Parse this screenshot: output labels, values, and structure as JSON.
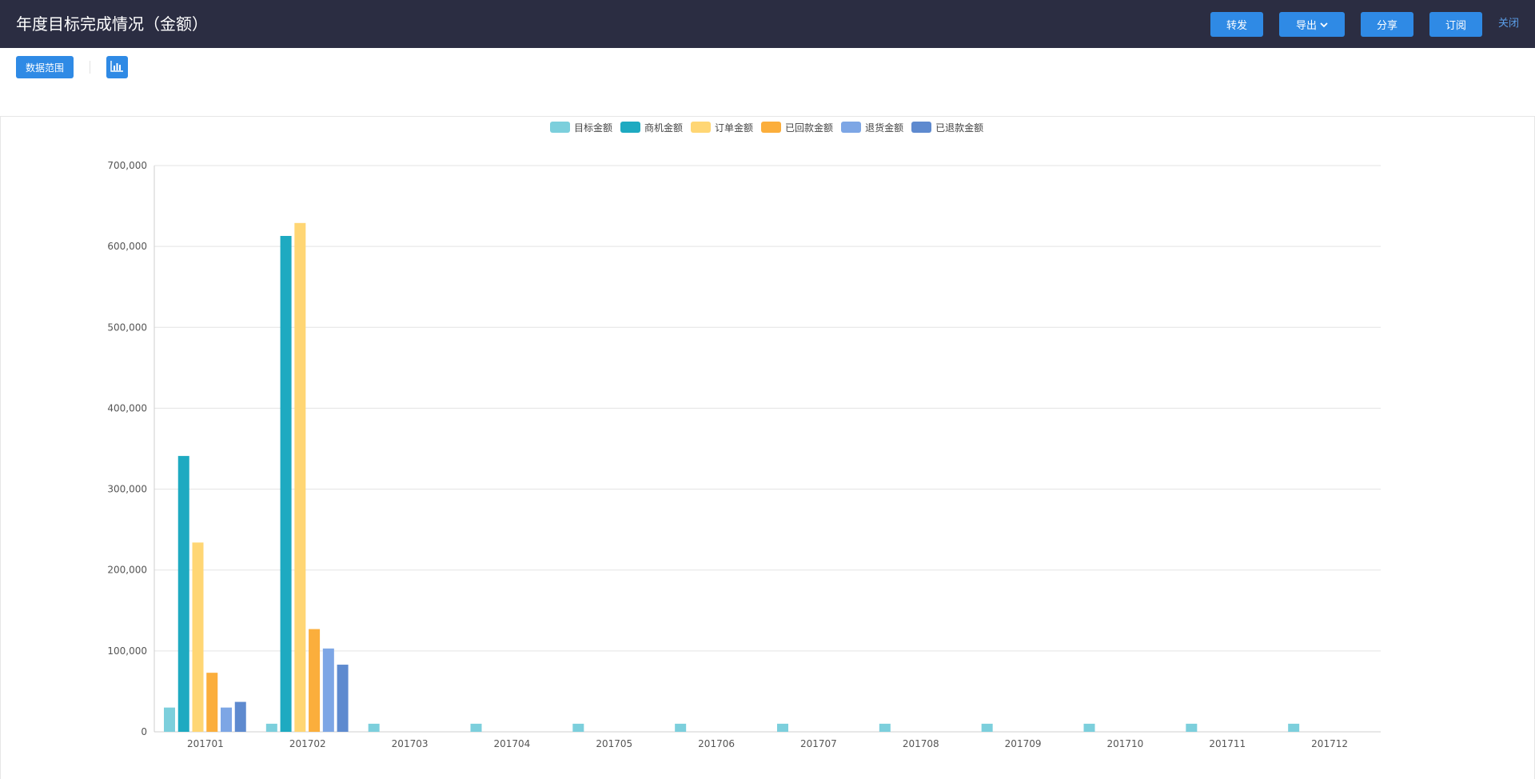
{
  "header": {
    "title": "年度目标完成情况（金额）",
    "buttons": {
      "forward": "转发",
      "export": "导出",
      "share": "分享",
      "subscribe": "订阅",
      "close": "关闭"
    }
  },
  "toolbar": {
    "data_range": "数据范围"
  },
  "colors": {
    "header_bg": "#2b2d42",
    "button": "#2f8ae5"
  },
  "chart_data": {
    "type": "bar",
    "categories": [
      "201701",
      "201702",
      "201703",
      "201704",
      "201705",
      "201706",
      "201707",
      "201708",
      "201709",
      "201710",
      "201711",
      "201712"
    ],
    "series": [
      {
        "name": "目标金额",
        "color": "#7ccfdc",
        "values": [
          30000,
          10000,
          10000,
          10000,
          10000,
          10000,
          10000,
          10000,
          10000,
          10000,
          10000,
          10000
        ]
      },
      {
        "name": "商机金额",
        "color": "#1eaac1",
        "values": [
          341000,
          613000,
          0,
          0,
          0,
          0,
          0,
          0,
          0,
          0,
          0,
          0
        ]
      },
      {
        "name": "订单金额",
        "color": "#ffd674",
        "values": [
          234000,
          629000,
          0,
          0,
          0,
          0,
          0,
          0,
          0,
          0,
          0,
          0
        ]
      },
      {
        "name": "已回款金额",
        "color": "#fbae3c",
        "values": [
          73000,
          127000,
          0,
          0,
          0,
          0,
          0,
          0,
          0,
          0,
          0,
          0
        ]
      },
      {
        "name": "退货金额",
        "color": "#7da6e5",
        "values": [
          30000,
          103000,
          0,
          0,
          0,
          0,
          0,
          0,
          0,
          0,
          0,
          0
        ]
      },
      {
        "name": "已退款金额",
        "color": "#5e8acf",
        "values": [
          37000,
          83000,
          0,
          0,
          0,
          0,
          0,
          0,
          0,
          0,
          0,
          0
        ]
      }
    ],
    "yticks": [
      "700,000",
      "600,000",
      "500,000",
      "400,000",
      "300,000",
      "200,000",
      "100,000",
      "0"
    ],
    "ylim": [
      0,
      700000
    ],
    "grid": true,
    "legend_position": "top-center"
  }
}
